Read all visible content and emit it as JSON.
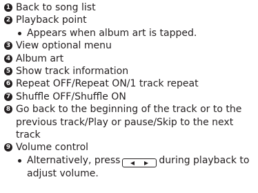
{
  "items": [
    {
      "num": "1",
      "text": "Back to song list"
    },
    {
      "num": "2",
      "text": "Playback point",
      "note": "Appears when album art is tapped."
    },
    {
      "num": "3",
      "text": "View optional menu"
    },
    {
      "num": "4",
      "text": "Album art"
    },
    {
      "num": "5",
      "text": "Show track information"
    },
    {
      "num": "6",
      "text": "Repeat OFF/Repeat ON/1 track repeat"
    },
    {
      "num": "7",
      "text": "Shuffle OFF/Shuffle ON"
    },
    {
      "num": "8",
      "text": "Go back to the beginning of the track or to the previous track/Play or pause/Skip to the next track"
    },
    {
      "num": "9",
      "text": "Volume control",
      "note_before": "Alternatively, press",
      "note_after": "during playback to adjust volume."
    }
  ],
  "icons": {
    "volume_key": "volume-down-up-key-icon"
  },
  "colors": {
    "text": "#231f20"
  }
}
